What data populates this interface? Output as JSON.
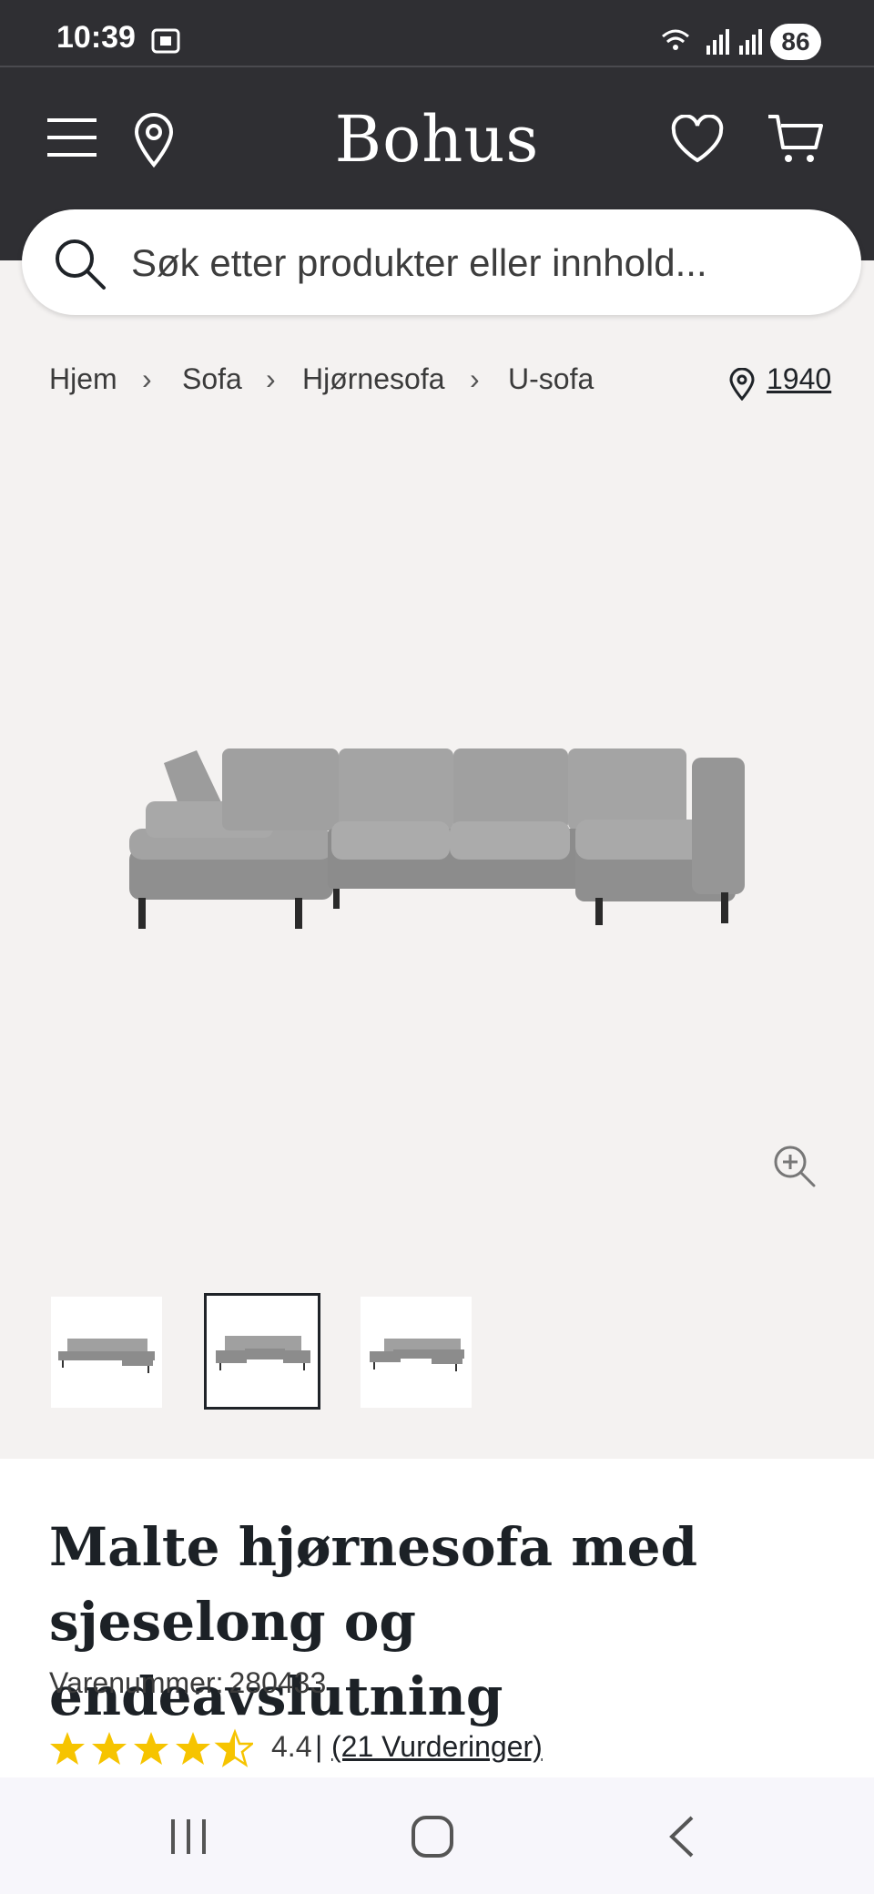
{
  "status_bar": {
    "time": "10:39",
    "battery": "86"
  },
  "header": {
    "brand": "Bohus"
  },
  "search": {
    "placeholder": "Søk etter produkter eller innhold..."
  },
  "breadcrumb": [
    "Hjem",
    "Sofa",
    "Hjørnesofa",
    "U-sofa"
  ],
  "store": {
    "number": "1940"
  },
  "product": {
    "title": "Malte hjørnesofa med sjeselong og endeavslutning",
    "sku_label": "Varenummer:",
    "sku": "280433",
    "rating_value": "4.4",
    "rating_stars": 4.4,
    "reviews_link": "(21 Vurderinger)",
    "thumbnails_count": 3,
    "selected_thumbnail": 2
  },
  "colors": {
    "header_bg": "#2f2f33",
    "page_bg": "#f4f2f1",
    "star": "#f6c400",
    "sofa": "#9a9a9a"
  },
  "icons": [
    "menu-icon",
    "location-pin-icon",
    "heart-icon",
    "cart-icon",
    "search-icon",
    "zoom-in-icon",
    "recent-apps-icon",
    "home-icon",
    "back-icon"
  ]
}
